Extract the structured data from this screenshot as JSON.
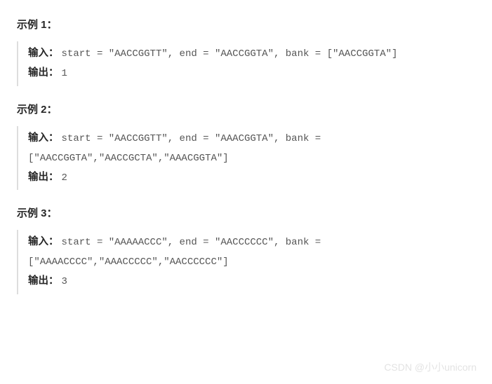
{
  "examples": [
    {
      "title": "示例 1：",
      "input_label": "输入：",
      "input_code": "start = \"AACCGGTT\", end = \"AACCGGTA\", bank = [\"AACCGGTA\"]",
      "output_label": "输出：",
      "output_code": "1"
    },
    {
      "title": "示例 2：",
      "input_label": "输入：",
      "input_code": "start = \"AACCGGTT\", end = \"AAACGGTA\", bank = [\"AACCGGTA\",\"AACCGCTA\",\"AAACGGTA\"]",
      "output_label": "输出：",
      "output_code": "2"
    },
    {
      "title": "示例 3：",
      "input_label": "输入：",
      "input_code": "start = \"AAAAACCC\", end = \"AACCCCCC\", bank = [\"AAAACCCC\",\"AAACCCCC\",\"AACCCCCC\"]",
      "output_label": "输出：",
      "output_code": "3"
    }
  ],
  "watermark": "CSDN @小小unicorn"
}
